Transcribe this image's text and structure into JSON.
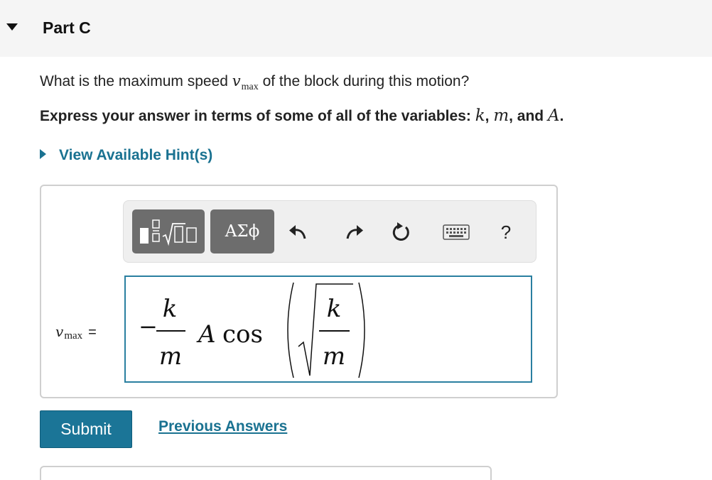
{
  "part": {
    "title": "Part C"
  },
  "question": {
    "text_before": "What is the maximum speed ",
    "var_symbol": "v",
    "var_subscript": "max",
    "text_after": " of the block during this motion?"
  },
  "instruction": {
    "text": "Express your answer in terms of some of all of the variables: ",
    "var1": "k",
    "sep1": ", ",
    "var2": "m",
    "sep2": ", and ",
    "var3": "A",
    "end": "."
  },
  "hint": {
    "label": "View Available Hint(s)"
  },
  "toolbar": {
    "templates_icon": "templates-icon",
    "symbols_label": "ΑΣϕ",
    "undo_icon": "undo-icon",
    "redo_icon": "redo-icon",
    "reset_icon": "reset-icon",
    "keyboard_icon": "keyboard-icon",
    "help_label": "?"
  },
  "answer": {
    "label_symbol": "v",
    "label_subscript": "max",
    "equals": "=",
    "expression": {
      "sign": "−",
      "fraction1_num": "k",
      "fraction1_den": "m",
      "coef": "A",
      "func": "cos",
      "fraction2_num": "k",
      "fraction2_den": "m"
    }
  },
  "buttons": {
    "submit": "Submit",
    "previous_answers": "Previous Answers"
  },
  "colors": {
    "accent": "#1a7291",
    "submit_bg": "#1b7597",
    "field_border": "#2a7fa0",
    "toolbar_btn": "#6d6d6d"
  }
}
